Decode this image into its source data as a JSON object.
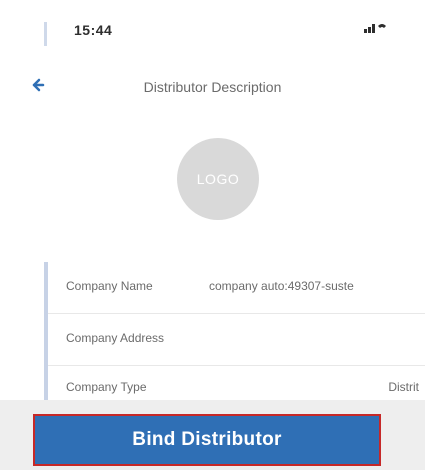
{
  "status_bar": {
    "time": "15:44",
    "icons": "⁘ᐧ⁠◔"
  },
  "nav": {
    "title": "Distributor Description"
  },
  "logo": {
    "text": "LOGO"
  },
  "info_rows": [
    {
      "label": "Company Name",
      "value": "company auto:49307-suste"
    },
    {
      "label": "Company Address",
      "value": ""
    },
    {
      "label": "Company Type",
      "value": "Distrit"
    }
  ],
  "actions": {
    "bind_label": "Bind Distributor"
  },
  "colors": {
    "accent": "#2f6fb5",
    "button_border": "#c62828",
    "rule": "#c7d2e6"
  }
}
